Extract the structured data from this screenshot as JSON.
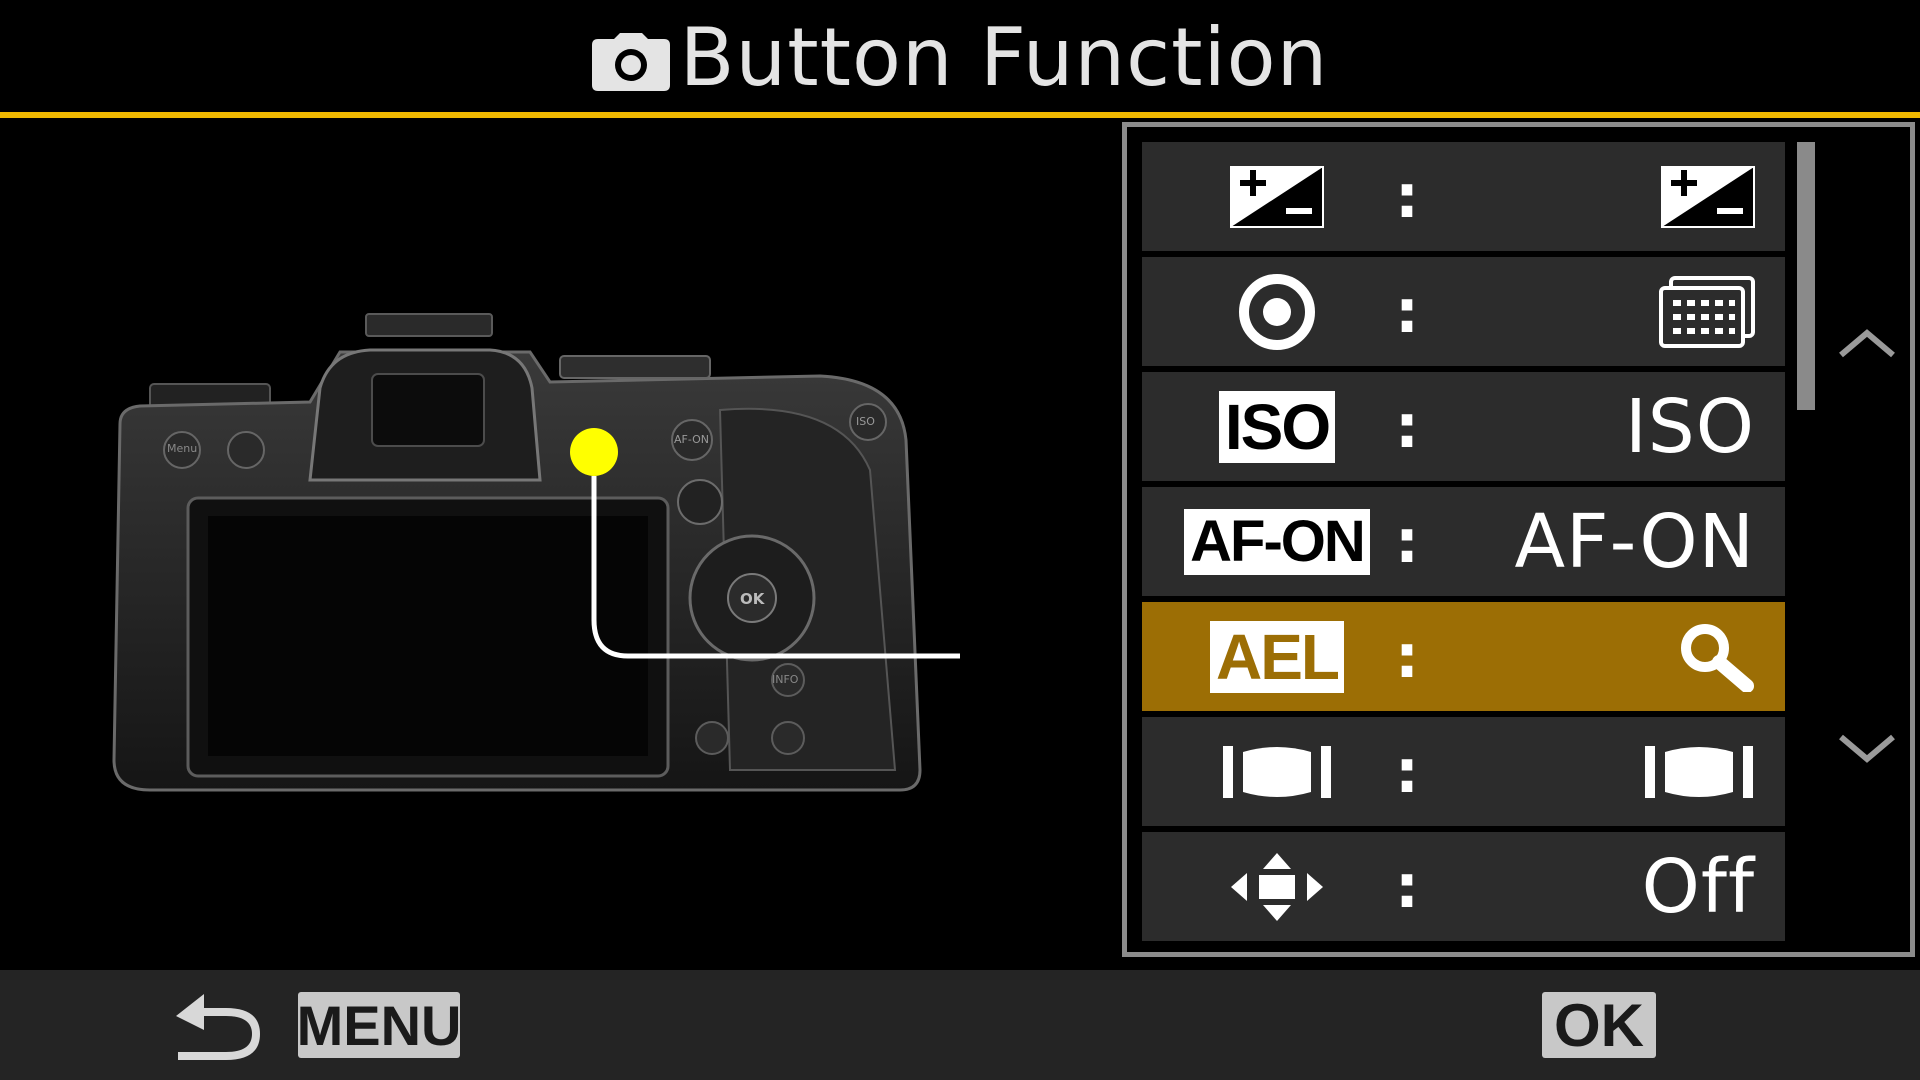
{
  "header": {
    "title": "Button Function",
    "icon": "camera-icon",
    "accent_color": "#f0b800"
  },
  "camera": {
    "illustration": "camera-rear-view",
    "highlight_color": "#ffff00",
    "button_labels": [
      "Menu",
      "AF-ON",
      "ISO",
      "OK",
      "INFO"
    ]
  },
  "list": {
    "rows": [
      {
        "control_icon": "exposure-compensation-icon",
        "assigned_icon": "exposure-compensation-icon",
        "assigned_text": ""
      },
      {
        "control_icon": "record-button-icon",
        "assigned_icon": "af-target-grid-icon",
        "assigned_text": ""
      },
      {
        "control_label": "ISO",
        "assigned_text": "ISO"
      },
      {
        "control_label": "AF-ON",
        "assigned_text": "AF-ON"
      },
      {
        "control_label": "AEL",
        "assigned_icon": "magnify-icon",
        "assigned_text": "",
        "selected": true
      },
      {
        "control_icon": "lens-function-button-icon",
        "assigned_icon": "lens-function-button-icon",
        "assigned_text": ""
      },
      {
        "control_icon": "arrow-pad-icon",
        "assigned_text": "Off"
      }
    ],
    "separator": ":",
    "selected_color": "#9c6e05",
    "row_color": "#2c2c2c"
  },
  "footer": {
    "back_key": "MENU",
    "confirm_key": "OK"
  }
}
